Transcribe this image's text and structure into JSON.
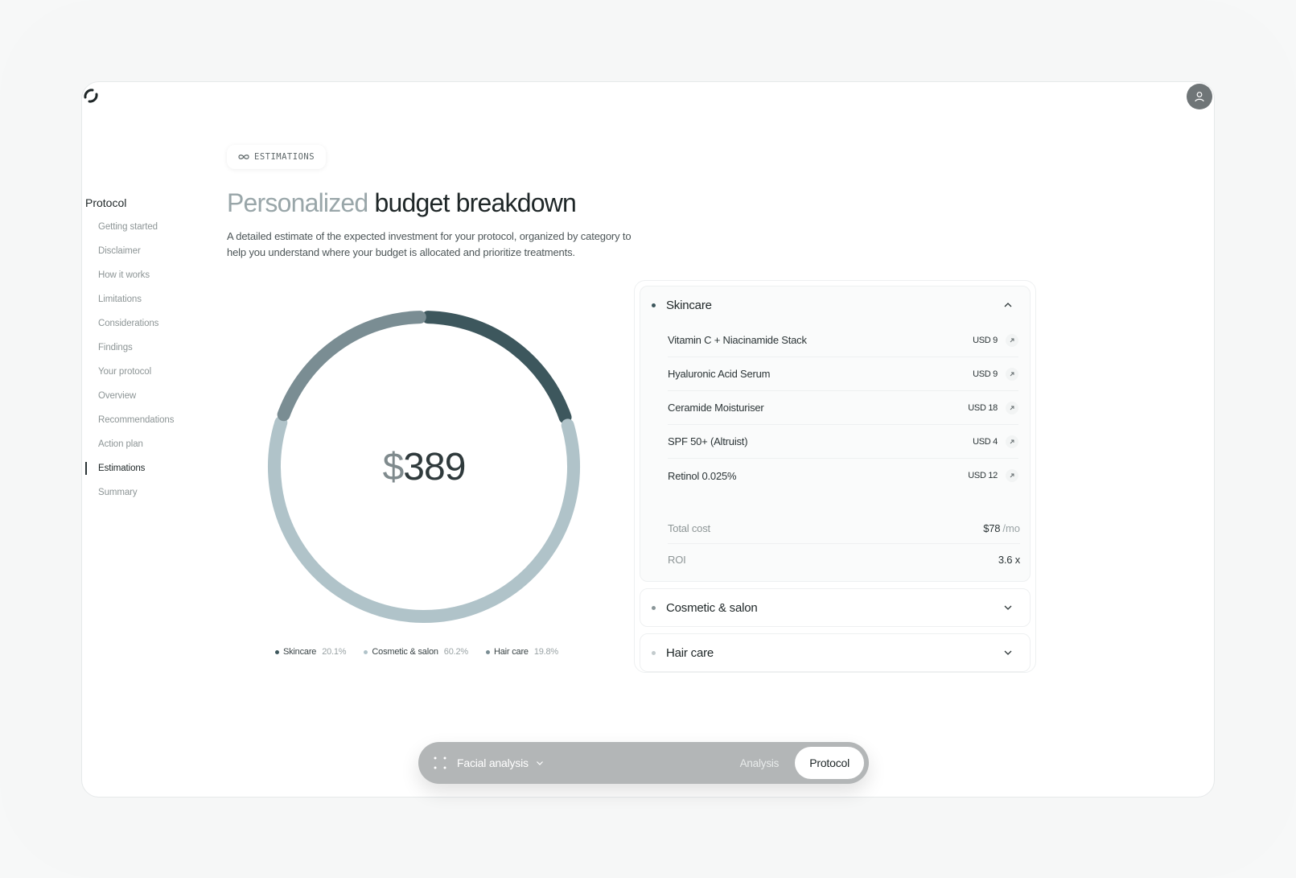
{
  "tag": {
    "label": "ESTIMATIONS",
    "icon": "infinity-icon"
  },
  "title": {
    "light": "Personalized",
    "dark": "budget breakdown"
  },
  "description": "A detailed estimate of the expected investment for your protocol, organized by category to help you understand where your budget is allocated and prioritize treatments.",
  "sidebar": {
    "section": "Protocol",
    "items": [
      {
        "label": "Getting started"
      },
      {
        "label": "Disclaimer"
      },
      {
        "label": "How it works"
      },
      {
        "label": "Limitations"
      },
      {
        "label": "Considerations"
      },
      {
        "label": "Findings"
      },
      {
        "label": "Your protocol"
      },
      {
        "label": "Overview"
      },
      {
        "label": "Recommendations"
      },
      {
        "label": "Action plan"
      },
      {
        "label": "Estimations"
      },
      {
        "label": "Summary"
      }
    ],
    "active_index": 10
  },
  "total": {
    "symbol": "$",
    "amount": "389"
  },
  "chart_data": {
    "type": "pie",
    "categories": [
      "Skincare",
      "Cosmetic & salon",
      "Hair care"
    ],
    "values": [
      20.1,
      60.2,
      19.8
    ],
    "labels": [
      "20.1%",
      "60.2%",
      "19.8%"
    ],
    "colors": [
      "#3d575d",
      "#b0c3c9",
      "#7a8d93"
    ],
    "legend_placement": "bottom"
  },
  "categories": [
    {
      "name": "Skincare",
      "dot_color": "#3d575d",
      "open": true,
      "items": [
        {
          "name": "Vitamin C + Niacinamide Stack",
          "price": "USD 9"
        },
        {
          "name": "Hyaluronic Acid Serum",
          "price": "USD 9"
        },
        {
          "name": "Ceramide Moisturiser",
          "price": "USD 18"
        },
        {
          "name": "SPF 50+ (Altruist)",
          "price": "USD 4"
        },
        {
          "name": "Retinol 0.025%",
          "price": "USD 12"
        }
      ],
      "total_label": "Total cost",
      "total_value": "$78",
      "total_unit": "/mo",
      "roi_label": "ROI",
      "roi_value": "3.6 x"
    },
    {
      "name": "Cosmetic & salon",
      "dot_color": "#8a9699",
      "open": false
    },
    {
      "name": "Hair care",
      "dot_color": "#c3cbcd",
      "open": false
    }
  ],
  "bottom_bar": {
    "label": "Facial analysis",
    "tab_analysis": "Analysis",
    "tab_protocol": "Protocol"
  }
}
